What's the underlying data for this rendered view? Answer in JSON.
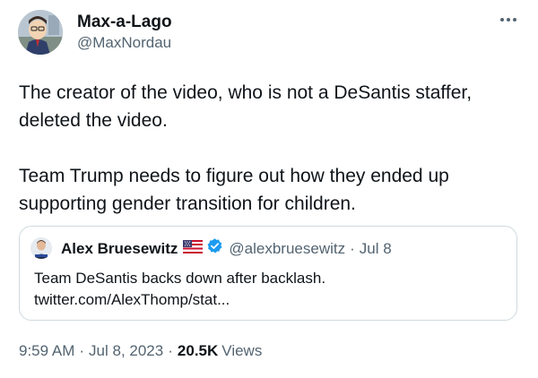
{
  "author": {
    "display_name": "Max-a-Lago",
    "handle": "@MaxNordau"
  },
  "tweet": {
    "paragraphs": [
      "The creator of the video, who is not a DeSantis staffer, deleted the video.",
      "Team Trump needs to figure out how they ended up supporting gender transition for children."
    ]
  },
  "quoted": {
    "display_name": "Alex Bruesewitz",
    "handle": "@alexbruesewitz",
    "date": "Jul 8",
    "text_line1": "Team DeSantis backs down after backlash.",
    "text_line2": "twitter.com/AlexThomp/stat..."
  },
  "meta": {
    "time": "9:59 AM",
    "date": "Jul 8, 2023",
    "views_count": "20.5K",
    "views_label": "Views"
  },
  "icons": {
    "more": "more-horizontal-icon",
    "verified": "verified-badge-icon",
    "flag": "us-flag-icon"
  },
  "colors": {
    "text_primary": "#0f1419",
    "text_secondary": "#536471",
    "border": "#cfd9de",
    "verified_blue": "#1d9bf0"
  }
}
